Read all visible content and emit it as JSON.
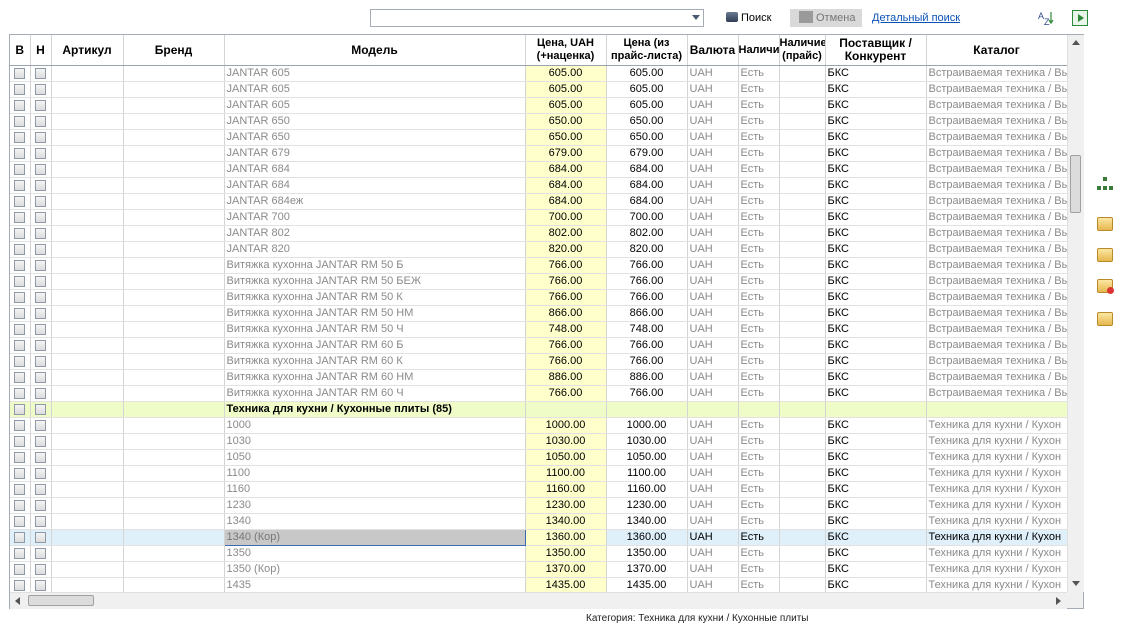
{
  "toolbar": {
    "search_value": "",
    "search_label": "Поиск",
    "cancel_label": "Отмена",
    "advanced_search_label": "Детальный поиск"
  },
  "columns": {
    "b": "В",
    "n": "Н",
    "article": "Артикул",
    "brand": "Бренд",
    "model": "Модель",
    "price_uah": "Цена, UAH (+наценка)",
    "price_list": "Цена (из прайс-листа)",
    "currency": "Валюта",
    "avail": "Наличи",
    "avail_price": "Наличие (прайс)",
    "supplier": "Поставщик / Конкурент",
    "catalog": "Каталог"
  },
  "rows": [
    {
      "model": "JANTAR 605",
      "price": "605.00",
      "price_list": "605.00",
      "currency": "UAH",
      "avail": "Есть",
      "supplier": "БКС",
      "catalog": "Встраиваемая техника / Вы"
    },
    {
      "model": "JANTAR 605",
      "price": "605.00",
      "price_list": "605.00",
      "currency": "UAH",
      "avail": "Есть",
      "supplier": "БКС",
      "catalog": "Встраиваемая техника / Вы"
    },
    {
      "model": "JANTAR 605",
      "price": "605.00",
      "price_list": "605.00",
      "currency": "UAH",
      "avail": "Есть",
      "supplier": "БКС",
      "catalog": "Встраиваемая техника / Вы"
    },
    {
      "model": "JANTAR 650",
      "price": "650.00",
      "price_list": "650.00",
      "currency": "UAH",
      "avail": "Есть",
      "supplier": "БКС",
      "catalog": "Встраиваемая техника / Вы"
    },
    {
      "model": "JANTAR 650",
      "price": "650.00",
      "price_list": "650.00",
      "currency": "UAH",
      "avail": "Есть",
      "supplier": "БКС",
      "catalog": "Встраиваемая техника / Вы"
    },
    {
      "model": "JANTAR 679",
      "price": "679.00",
      "price_list": "679.00",
      "currency": "UAH",
      "avail": "Есть",
      "supplier": "БКС",
      "catalog": "Встраиваемая техника / Вы"
    },
    {
      "model": "JANTAR 684",
      "price": "684.00",
      "price_list": "684.00",
      "currency": "UAH",
      "avail": "Есть",
      "supplier": "БКС",
      "catalog": "Встраиваемая техника / Вы"
    },
    {
      "model": "JANTAR 684",
      "price": "684.00",
      "price_list": "684.00",
      "currency": "UAH",
      "avail": "Есть",
      "supplier": "БКС",
      "catalog": "Встраиваемая техника / Вы"
    },
    {
      "model": "JANTAR 684еж",
      "price": "684.00",
      "price_list": "684.00",
      "currency": "UAH",
      "avail": "Есть",
      "supplier": "БКС",
      "catalog": "Встраиваемая техника / Вы"
    },
    {
      "model": "JANTAR 700",
      "price": "700.00",
      "price_list": "700.00",
      "currency": "UAH",
      "avail": "Есть",
      "supplier": "БКС",
      "catalog": "Встраиваемая техника / Вы"
    },
    {
      "model": "JANTAR 802",
      "price": "802.00",
      "price_list": "802.00",
      "currency": "UAH",
      "avail": "Есть",
      "supplier": "БКС",
      "catalog": "Встраиваемая техника / Вы"
    },
    {
      "model": "JANTAR 820",
      "price": "820.00",
      "price_list": "820.00",
      "currency": "UAH",
      "avail": "Есть",
      "supplier": "БКС",
      "catalog": "Встраиваемая техника / Вы"
    },
    {
      "model": "Витяжка кухонна JANTAR RM 50 Б",
      "price": "766.00",
      "price_list": "766.00",
      "currency": "UAH",
      "avail": "Есть",
      "supplier": "БКС",
      "catalog": "Встраиваемая техника / Вы"
    },
    {
      "model": "Витяжка кухонна JANTAR RM 50 БЕЖ",
      "price": "766.00",
      "price_list": "766.00",
      "currency": "UAH",
      "avail": "Есть",
      "supplier": "БКС",
      "catalog": "Встраиваемая техника / Вы"
    },
    {
      "model": "Витяжка кухонна JANTAR RM 50 К",
      "price": "766.00",
      "price_list": "766.00",
      "currency": "UAH",
      "avail": "Есть",
      "supplier": "БКС",
      "catalog": "Встраиваемая техника / Вы"
    },
    {
      "model": "Витяжка кухонна JANTAR RM 50 НМ",
      "price": "866.00",
      "price_list": "866.00",
      "currency": "UAH",
      "avail": "Есть",
      "supplier": "БКС",
      "catalog": "Встраиваемая техника / Вы"
    },
    {
      "model": "Витяжка кухонна JANTAR RM 50 Ч",
      "price": "748.00",
      "price_list": "748.00",
      "currency": "UAH",
      "avail": "Есть",
      "supplier": "БКС",
      "catalog": "Встраиваемая техника / Вы"
    },
    {
      "model": "Витяжка кухонна JANTAR RM 60 Б",
      "price": "766.00",
      "price_list": "766.00",
      "currency": "UAH",
      "avail": "Есть",
      "supplier": "БКС",
      "catalog": "Встраиваемая техника / Вы"
    },
    {
      "model": "Витяжка кухонна JANTAR RM 60 К",
      "price": "766.00",
      "price_list": "766.00",
      "currency": "UAH",
      "avail": "Есть",
      "supplier": "БКС",
      "catalog": "Встраиваемая техника / Вы"
    },
    {
      "model": "Витяжка кухонна JANTAR RM 60 НМ",
      "price": "886.00",
      "price_list": "886.00",
      "currency": "UAH",
      "avail": "Есть",
      "supplier": "БКС",
      "catalog": "Встраиваемая техника / Вы"
    },
    {
      "model": "Витяжка кухонна JANTAR RM 60 Ч",
      "price": "766.00",
      "price_list": "766.00",
      "currency": "UAH",
      "avail": "Есть",
      "supplier": "БКС",
      "catalog": "Встраиваемая техника / Вы"
    },
    {
      "group": "Техника для кухни / Кухонные плиты (85)"
    },
    {
      "model": "1000",
      "price": "1000.00",
      "price_list": "1000.00",
      "currency": "UAH",
      "avail": "Есть",
      "supplier": "БКС",
      "catalog": "Техника для кухни / Кухон"
    },
    {
      "model": "1030",
      "price": "1030.00",
      "price_list": "1030.00",
      "currency": "UAH",
      "avail": "Есть",
      "supplier": "БКС",
      "catalog": "Техника для кухни / Кухон"
    },
    {
      "model": "1050",
      "price": "1050.00",
      "price_list": "1050.00",
      "currency": "UAH",
      "avail": "Есть",
      "supplier": "БКС",
      "catalog": "Техника для кухни / Кухон"
    },
    {
      "model": "1100",
      "price": "1100.00",
      "price_list": "1100.00",
      "currency": "UAH",
      "avail": "Есть",
      "supplier": "БКС",
      "catalog": "Техника для кухни / Кухон"
    },
    {
      "model": "1160",
      "price": "1160.00",
      "price_list": "1160.00",
      "currency": "UAH",
      "avail": "Есть",
      "supplier": "БКС",
      "catalog": "Техника для кухни / Кухон"
    },
    {
      "model": "1230",
      "price": "1230.00",
      "price_list": "1230.00",
      "currency": "UAH",
      "avail": "Есть",
      "supplier": "БКС",
      "catalog": "Техника для кухни / Кухон"
    },
    {
      "model": "1340",
      "price": "1340.00",
      "price_list": "1340.00",
      "currency": "UAH",
      "avail": "Есть",
      "supplier": "БКС",
      "catalog": "Техника для кухни / Кухон"
    },
    {
      "model": "1340 (Кор)",
      "price": "1360.00",
      "price_list": "1360.00",
      "currency": "UAH",
      "avail": "Есть",
      "supplier": "БКС",
      "catalog": "Техника для кухни / Кухон",
      "selected": true
    },
    {
      "model": "1350",
      "price": "1350.00",
      "price_list": "1350.00",
      "currency": "UAH",
      "avail": "Есть",
      "supplier": "БКС",
      "catalog": "Техника для кухни / Кухон"
    },
    {
      "model": "1350 (Кор)",
      "price": "1370.00",
      "price_list": "1370.00",
      "currency": "UAH",
      "avail": "Есть",
      "supplier": "БКС",
      "catalog": "Техника для кухни / Кухон"
    },
    {
      "model": "1435",
      "price": "1435.00",
      "price_list": "1435.00",
      "currency": "UAH",
      "avail": "Есть",
      "supplier": "БКС",
      "catalog": "Техника для кухни / Кухон"
    }
  ],
  "status_bar": "Категория: Техника для кухни / Кухонные плиты"
}
